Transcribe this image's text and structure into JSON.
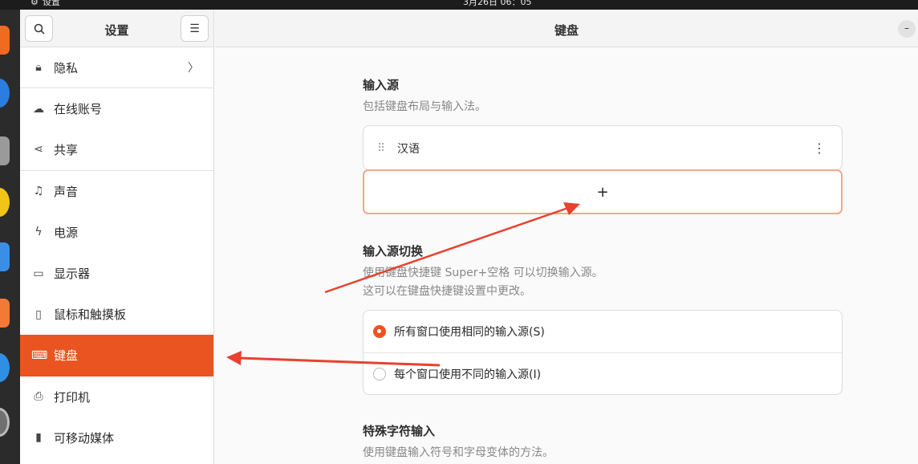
{
  "topbar": {
    "app_name": "设置",
    "clock": "3月26日 06：05"
  },
  "sidebar": {
    "title": "设置",
    "items": [
      {
        "label": "隐私",
        "icon": "lock-icon",
        "has_chevron": true
      },
      {
        "label": "在线账号",
        "icon": "cloud-icon"
      },
      {
        "label": "共享",
        "icon": "share-icon"
      },
      {
        "label": "声音",
        "icon": "music-note-icon"
      },
      {
        "label": "电源",
        "icon": "power-icon"
      },
      {
        "label": "显示器",
        "icon": "display-icon"
      },
      {
        "label": "鼠标和触摸板",
        "icon": "mouse-icon"
      },
      {
        "label": "键盘",
        "icon": "keyboard-icon",
        "active": true
      },
      {
        "label": "打印机",
        "icon": "printer-icon"
      },
      {
        "label": "可移动媒体",
        "icon": "removable-media-icon"
      }
    ]
  },
  "main": {
    "title": "键盘",
    "input_sources": {
      "title": "输入源",
      "description": "包括键盘布局与输入法。",
      "items": [
        "汉语"
      ],
      "add_label": "+"
    },
    "switching": {
      "title": "输入源切换",
      "description_line1": "使用键盘快捷键 Super+空格 可以切换输入源。",
      "description_line2": "这可以在键盘快捷键设置中更改。",
      "options": [
        {
          "label": "所有窗口使用相同的输入源(S)",
          "selected": true
        },
        {
          "label": "每个窗口使用不同的输入源(I)",
          "selected": false
        }
      ]
    },
    "special_chars": {
      "title": "特殊字符输入",
      "description": "使用键盘输入符号和字母变体的方法。"
    }
  },
  "colors": {
    "accent": "#e95420",
    "annotation_arrow": "#e8412f"
  }
}
